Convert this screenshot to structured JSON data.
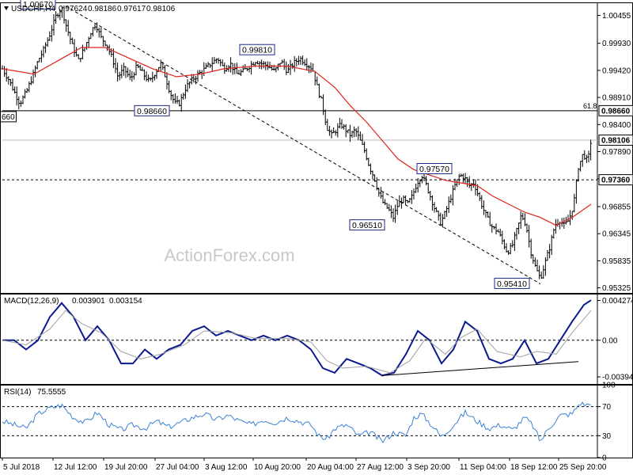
{
  "chart_data": [
    {
      "type": "candlestick",
      "title": "USDCHF,H4",
      "ohlc_header": [
        "0.97624",
        "0.98186",
        "0.97617",
        "0.98106"
      ],
      "watermark": "ActionForex.com",
      "ylim": [
        0.9523,
        1.007
      ],
      "y_ticks": [
        1.00455,
        0.9993,
        0.9942,
        0.9891,
        0.984,
        0.9789,
        0.9738,
        0.96855,
        0.96345,
        0.95835,
        0.95325
      ],
      "x_labels": [
        "5 Jul 2018",
        "12 Jul 12:00",
        "19 Jul 20:00",
        "27 Jul 04:00",
        "3 Aug 12:00",
        "10 Aug 20:00",
        "20 Aug 04:00",
        "27 Aug 12:00",
        "3 Sep 20:00",
        "11 Sep 04:00",
        "18 Sep 12:00",
        "25 Sep 20:00"
      ],
      "horizontal_lines": [
        {
          "value": 0.9866,
          "label": "0.98660",
          "style": "solid",
          "note": "61.8"
        },
        {
          "value": 0.9736,
          "label": "0.97360",
          "style": "dashed"
        },
        {
          "value": 0.98106,
          "label": "0.98106",
          "style": "current"
        }
      ],
      "left_edge_label": "660",
      "annotations": [
        {
          "label": "1.00670",
          "value": 1.0067
        },
        {
          "label": "0.98660",
          "value": 0.9866
        },
        {
          "label": "0.99810",
          "value": 0.9981
        },
        {
          "label": "0.96510",
          "value": 0.9651
        },
        {
          "label": "0.97570",
          "value": 0.9757
        },
        {
          "label": "0.95410",
          "value": 0.9541
        }
      ],
      "price_path": [
        [
          0,
          0.9945
        ],
        [
          8,
          0.9925
        ],
        [
          14,
          0.9905
        ],
        [
          22,
          0.988
        ],
        [
          30,
          0.99
        ],
        [
          38,
          0.993
        ],
        [
          45,
          0.996
        ],
        [
          52,
          0.998
        ],
        [
          60,
          1.001
        ],
        [
          68,
          1.0045
        ],
        [
          75,
          1.006
        ],
        [
          80,
          1.003
        ],
        [
          88,
          0.999
        ],
        [
          96,
          0.996
        ],
        [
          104,
          0.9985
        ],
        [
          112,
          1.0015
        ],
        [
          118,
          1.003
        ],
        [
          124,
          1.0005
        ],
        [
          132,
          0.999
        ],
        [
          140,
          0.996
        ],
        [
          146,
          0.993
        ],
        [
          154,
          0.9945
        ],
        [
          162,
          0.9925
        ],
        [
          170,
          0.995
        ],
        [
          178,
          0.9935
        ],
        [
          186,
          0.992
        ],
        [
          194,
          0.994
        ],
        [
          200,
          0.9955
        ],
        [
          206,
          0.993
        ],
        [
          212,
          0.99
        ],
        [
          218,
          0.988
        ],
        [
          224,
          0.988
        ],
        [
          232,
          0.991
        ],
        [
          240,
          0.9925
        ],
        [
          248,
          0.9935
        ],
        [
          256,
          0.9945
        ],
        [
          264,
          0.9955
        ],
        [
          272,
          0.9965
        ],
        [
          280,
          0.9945
        ],
        [
          288,
          0.9955
        ],
        [
          296,
          0.9935
        ],
        [
          304,
          0.994
        ],
        [
          312,
          0.995
        ],
        [
          320,
          0.996
        ],
        [
          328,
          0.9955
        ],
        [
          336,
          0.995
        ],
        [
          344,
          0.994
        ],
        [
          352,
          0.996
        ],
        [
          360,
          0.994
        ],
        [
          368,
          0.9955
        ],
        [
          376,
          0.9965
        ],
        [
          384,
          0.9955
        ],
        [
          392,
          0.9945
        ],
        [
          398,
          0.991
        ],
        [
          404,
          0.988
        ],
        [
          410,
          0.9835
        ],
        [
          416,
          0.982
        ],
        [
          422,
          0.983
        ],
        [
          428,
          0.984
        ],
        [
          434,
          0.983
        ],
        [
          440,
          0.982
        ],
        [
          446,
          0.983
        ],
        [
          452,
          0.981
        ],
        [
          458,
          0.979
        ],
        [
          464,
          0.976
        ],
        [
          470,
          0.974
        ],
        [
          476,
          0.971
        ],
        [
          482,
          0.969
        ],
        [
          488,
          0.968
        ],
        [
          494,
          0.9665
        ],
        [
          500,
          0.969
        ],
        [
          506,
          0.97
        ],
        [
          512,
          0.969
        ],
        [
          518,
          0.9705
        ],
        [
          524,
          0.973
        ],
        [
          530,
          0.9745
        ],
        [
          536,
          0.9725
        ],
        [
          542,
          0.97
        ],
        [
          548,
          0.9675
        ],
        [
          554,
          0.9655
        ],
        [
          560,
          0.9675
        ],
        [
          566,
          0.97
        ],
        [
          572,
          0.9725
        ],
        [
          578,
          0.9745
        ],
        [
          584,
          0.974
        ],
        [
          590,
          0.9725
        ],
        [
          596,
          0.973
        ],
        [
          602,
          0.9705
        ],
        [
          608,
          0.968
        ],
        [
          614,
          0.966
        ],
        [
          620,
          0.9645
        ],
        [
          626,
          0.964
        ],
        [
          632,
          0.962
        ],
        [
          638,
          0.96
        ],
        [
          644,
          0.961
        ],
        [
          650,
          0.964
        ],
        [
          656,
          0.967
        ],
        [
          662,
          0.965
        ],
        [
          668,
          0.96
        ],
        [
          674,
          0.957
        ],
        [
          680,
          0.955
        ],
        [
          686,
          0.958
        ],
        [
          692,
          0.961
        ],
        [
          698,
          0.965
        ],
        [
          704,
          0.966
        ],
        [
          710,
          0.965
        ],
        [
          716,
          0.966
        ],
        [
          722,
          0.969
        ],
        [
          728,
          0.976
        ],
        [
          734,
          0.9785
        ],
        [
          740,
          0.977
        ],
        [
          744,
          0.9811
        ]
      ],
      "ma_path": [
        [
          0,
          0.9945
        ],
        [
          40,
          0.9935
        ],
        [
          70,
          0.996
        ],
        [
          100,
          0.9985
        ],
        [
          130,
          0.9985
        ],
        [
          160,
          0.9965
        ],
        [
          190,
          0.9945
        ],
        [
          220,
          0.993
        ],
        [
          250,
          0.9935
        ],
        [
          280,
          0.9945
        ],
        [
          320,
          0.995
        ],
        [
          360,
          0.995
        ],
        [
          395,
          0.994
        ],
        [
          420,
          0.991
        ],
        [
          440,
          0.9875
        ],
        [
          460,
          0.9845
        ],
        [
          480,
          0.981
        ],
        [
          500,
          0.9775
        ],
        [
          520,
          0.9755
        ],
        [
          540,
          0.9745
        ],
        [
          560,
          0.9735
        ],
        [
          580,
          0.973
        ],
        [
          600,
          0.9725
        ],
        [
          620,
          0.9705
        ],
        [
          640,
          0.969
        ],
        [
          660,
          0.9675
        ],
        [
          680,
          0.9665
        ],
        [
          700,
          0.965
        ],
        [
          720,
          0.9665
        ],
        [
          744,
          0.969
        ]
      ],
      "trendline": [
        [
          80,
          1.0063
        ],
        [
          680,
          0.954
        ]
      ],
      "legend_placement": "top-left"
    },
    {
      "type": "line",
      "title": "MACD(12,26,9)",
      "header_values": [
        "0.003901",
        "0.003154"
      ],
      "ylim": [
        -0.0047,
        0.005
      ],
      "y_ticks": [
        0.004274,
        0.0,
        -0.003941
      ],
      "y_tick_labels": [
        "0.004274",
        "0.00",
        "-0.003941"
      ],
      "series": [
        {
          "role": "macd",
          "values": [
            [
              0,
              0.0
            ],
            [
              15,
              0.0
            ],
            [
              30,
              -0.001
            ],
            [
              45,
              0.0
            ],
            [
              60,
              0.0025
            ],
            [
              75,
              0.004
            ],
            [
              90,
              0.0025
            ],
            [
              105,
              0.0
            ],
            [
              120,
              0.0015
            ],
            [
              135,
              0.0
            ],
            [
              150,
              -0.0025
            ],
            [
              165,
              -0.0025
            ],
            [
              180,
              -0.001
            ],
            [
              195,
              -0.002
            ],
            [
              210,
              -0.001
            ],
            [
              225,
              -0.0005
            ],
            [
              240,
              0.001
            ],
            [
              255,
              0.0015
            ],
            [
              270,
              0.0005
            ],
            [
              285,
              0.001
            ],
            [
              300,
              0.0005
            ],
            [
              315,
              0.0
            ],
            [
              330,
              0.0005
            ],
            [
              345,
              0.0
            ],
            [
              360,
              0.0005
            ],
            [
              375,
              0.0
            ],
            [
              390,
              -0.001
            ],
            [
              405,
              -0.003
            ],
            [
              420,
              -0.0035
            ],
            [
              435,
              -0.002
            ],
            [
              450,
              -0.0025
            ],
            [
              465,
              -0.003
            ],
            [
              480,
              -0.0038
            ],
            [
              495,
              -0.0035
            ],
            [
              510,
              -0.0015
            ],
            [
              525,
              0.001
            ],
            [
              540,
              0.0
            ],
            [
              555,
              -0.0025
            ],
            [
              570,
              -0.001
            ],
            [
              585,
              0.002
            ],
            [
              600,
              0.001
            ],
            [
              615,
              -0.002
            ],
            [
              630,
              -0.0025
            ],
            [
              645,
              -0.002
            ],
            [
              660,
              0.0
            ],
            [
              675,
              -0.0025
            ],
            [
              690,
              -0.002
            ],
            [
              705,
              0.0
            ],
            [
              720,
              0.002
            ],
            [
              735,
              0.0038
            ],
            [
              744,
              0.0043
            ]
          ]
        },
        {
          "role": "signal",
          "values": [
            [
              0,
              0.0
            ],
            [
              30,
              -0.0005
            ],
            [
              60,
              0.0012
            ],
            [
              80,
              0.0032
            ],
            [
              100,
              0.0018
            ],
            [
              125,
              0.0008
            ],
            [
              150,
              -0.0012
            ],
            [
              175,
              -0.002
            ],
            [
              200,
              -0.0015
            ],
            [
              230,
              -0.0005
            ],
            [
              255,
              0.001
            ],
            [
              290,
              0.0008
            ],
            [
              320,
              0.0002
            ],
            [
              360,
              0.0002
            ],
            [
              390,
              -0.0002
            ],
            [
              410,
              -0.0022
            ],
            [
              430,
              -0.003
            ],
            [
              460,
              -0.0028
            ],
            [
              490,
              -0.0035
            ],
            [
              515,
              -0.0022
            ],
            [
              535,
              0.0002
            ],
            [
              560,
              -0.0015
            ],
            [
              580,
              0.0003
            ],
            [
              600,
              0.0012
            ],
            [
              625,
              -0.0012
            ],
            [
              655,
              -0.0018
            ],
            [
              675,
              -0.0012
            ],
            [
              700,
              -0.0015
            ],
            [
              720,
              0.0008
            ],
            [
              744,
              0.0032
            ]
          ]
        }
      ],
      "trendline": [
        [
          480,
          -0.0038
        ],
        [
          728,
          -0.0023
        ]
      ],
      "zero_line": true
    },
    {
      "type": "line",
      "title": "RSI(14)",
      "header_values": [
        "75.5555"
      ],
      "ylim": [
        0,
        100
      ],
      "y_ticks": [
        100,
        70,
        30,
        0
      ],
      "y_tick_labels": [
        "100",
        "70",
        "30",
        "0"
      ],
      "reference_levels": [
        70,
        30
      ],
      "series": [
        {
          "role": "rsi",
          "values": [
            [
              0,
              50
            ],
            [
              15,
              45
            ],
            [
              30,
              40
            ],
            [
              45,
              60
            ],
            [
              60,
              68
            ],
            [
              75,
              72
            ],
            [
              90,
              55
            ],
            [
              105,
              48
            ],
            [
              120,
              62
            ],
            [
              135,
              45
            ],
            [
              150,
              38
            ],
            [
              165,
              45
            ],
            [
              180,
              40
            ],
            [
              195,
              50
            ],
            [
              210,
              42
            ],
            [
              225,
              48
            ],
            [
              240,
              55
            ],
            [
              255,
              60
            ],
            [
              270,
              52
            ],
            [
              285,
              58
            ],
            [
              300,
              50
            ],
            [
              315,
              45
            ],
            [
              330,
              52
            ],
            [
              345,
              48
            ],
            [
              360,
              55
            ],
            [
              375,
              50
            ],
            [
              390,
              45
            ],
            [
              400,
              30
            ],
            [
              410,
              25
            ],
            [
              420,
              40
            ],
            [
              435,
              45
            ],
            [
              450,
              30
            ],
            [
              465,
              35
            ],
            [
              480,
              22
            ],
            [
              495,
              35
            ],
            [
              510,
              30
            ],
            [
              520,
              55
            ],
            [
              530,
              60
            ],
            [
              545,
              42
            ],
            [
              555,
              28
            ],
            [
              570,
              45
            ],
            [
              585,
              62
            ],
            [
              600,
              50
            ],
            [
              615,
              40
            ],
            [
              630,
              45
            ],
            [
              645,
              38
            ],
            [
              660,
              55
            ],
            [
              670,
              45
            ],
            [
              680,
              22
            ],
            [
              690,
              40
            ],
            [
              705,
              58
            ],
            [
              720,
              60
            ],
            [
              730,
              75
            ],
            [
              738,
              72
            ],
            [
              744,
              75.5
            ]
          ]
        }
      ]
    }
  ]
}
